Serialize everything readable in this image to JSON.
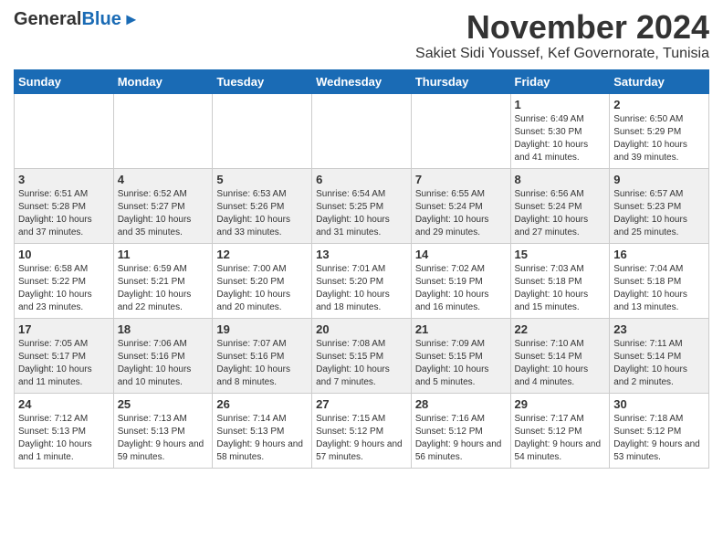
{
  "header": {
    "logo_general": "General",
    "logo_blue": "Blue",
    "month_title": "November 2024",
    "location": "Sakiet Sidi Youssef, Kef Governorate, Tunisia"
  },
  "calendar": {
    "days_of_week": [
      "Sunday",
      "Monday",
      "Tuesday",
      "Wednesday",
      "Thursday",
      "Friday",
      "Saturday"
    ],
    "weeks": [
      [
        {
          "day": "",
          "info": ""
        },
        {
          "day": "",
          "info": ""
        },
        {
          "day": "",
          "info": ""
        },
        {
          "day": "",
          "info": ""
        },
        {
          "day": "",
          "info": ""
        },
        {
          "day": "1",
          "info": "Sunrise: 6:49 AM\nSunset: 5:30 PM\nDaylight: 10 hours and 41 minutes."
        },
        {
          "day": "2",
          "info": "Sunrise: 6:50 AM\nSunset: 5:29 PM\nDaylight: 10 hours and 39 minutes."
        }
      ],
      [
        {
          "day": "3",
          "info": "Sunrise: 6:51 AM\nSunset: 5:28 PM\nDaylight: 10 hours and 37 minutes."
        },
        {
          "day": "4",
          "info": "Sunrise: 6:52 AM\nSunset: 5:27 PM\nDaylight: 10 hours and 35 minutes."
        },
        {
          "day": "5",
          "info": "Sunrise: 6:53 AM\nSunset: 5:26 PM\nDaylight: 10 hours and 33 minutes."
        },
        {
          "day": "6",
          "info": "Sunrise: 6:54 AM\nSunset: 5:25 PM\nDaylight: 10 hours and 31 minutes."
        },
        {
          "day": "7",
          "info": "Sunrise: 6:55 AM\nSunset: 5:24 PM\nDaylight: 10 hours and 29 minutes."
        },
        {
          "day": "8",
          "info": "Sunrise: 6:56 AM\nSunset: 5:24 PM\nDaylight: 10 hours and 27 minutes."
        },
        {
          "day": "9",
          "info": "Sunrise: 6:57 AM\nSunset: 5:23 PM\nDaylight: 10 hours and 25 minutes."
        }
      ],
      [
        {
          "day": "10",
          "info": "Sunrise: 6:58 AM\nSunset: 5:22 PM\nDaylight: 10 hours and 23 minutes."
        },
        {
          "day": "11",
          "info": "Sunrise: 6:59 AM\nSunset: 5:21 PM\nDaylight: 10 hours and 22 minutes."
        },
        {
          "day": "12",
          "info": "Sunrise: 7:00 AM\nSunset: 5:20 PM\nDaylight: 10 hours and 20 minutes."
        },
        {
          "day": "13",
          "info": "Sunrise: 7:01 AM\nSunset: 5:20 PM\nDaylight: 10 hours and 18 minutes."
        },
        {
          "day": "14",
          "info": "Sunrise: 7:02 AM\nSunset: 5:19 PM\nDaylight: 10 hours and 16 minutes."
        },
        {
          "day": "15",
          "info": "Sunrise: 7:03 AM\nSunset: 5:18 PM\nDaylight: 10 hours and 15 minutes."
        },
        {
          "day": "16",
          "info": "Sunrise: 7:04 AM\nSunset: 5:18 PM\nDaylight: 10 hours and 13 minutes."
        }
      ],
      [
        {
          "day": "17",
          "info": "Sunrise: 7:05 AM\nSunset: 5:17 PM\nDaylight: 10 hours and 11 minutes."
        },
        {
          "day": "18",
          "info": "Sunrise: 7:06 AM\nSunset: 5:16 PM\nDaylight: 10 hours and 10 minutes."
        },
        {
          "day": "19",
          "info": "Sunrise: 7:07 AM\nSunset: 5:16 PM\nDaylight: 10 hours and 8 minutes."
        },
        {
          "day": "20",
          "info": "Sunrise: 7:08 AM\nSunset: 5:15 PM\nDaylight: 10 hours and 7 minutes."
        },
        {
          "day": "21",
          "info": "Sunrise: 7:09 AM\nSunset: 5:15 PM\nDaylight: 10 hours and 5 minutes."
        },
        {
          "day": "22",
          "info": "Sunrise: 7:10 AM\nSunset: 5:14 PM\nDaylight: 10 hours and 4 minutes."
        },
        {
          "day": "23",
          "info": "Sunrise: 7:11 AM\nSunset: 5:14 PM\nDaylight: 10 hours and 2 minutes."
        }
      ],
      [
        {
          "day": "24",
          "info": "Sunrise: 7:12 AM\nSunset: 5:13 PM\nDaylight: 10 hours and 1 minute."
        },
        {
          "day": "25",
          "info": "Sunrise: 7:13 AM\nSunset: 5:13 PM\nDaylight: 9 hours and 59 minutes."
        },
        {
          "day": "26",
          "info": "Sunrise: 7:14 AM\nSunset: 5:13 PM\nDaylight: 9 hours and 58 minutes."
        },
        {
          "day": "27",
          "info": "Sunrise: 7:15 AM\nSunset: 5:12 PM\nDaylight: 9 hours and 57 minutes."
        },
        {
          "day": "28",
          "info": "Sunrise: 7:16 AM\nSunset: 5:12 PM\nDaylight: 9 hours and 56 minutes."
        },
        {
          "day": "29",
          "info": "Sunrise: 7:17 AM\nSunset: 5:12 PM\nDaylight: 9 hours and 54 minutes."
        },
        {
          "day": "30",
          "info": "Sunrise: 7:18 AM\nSunset: 5:12 PM\nDaylight: 9 hours and 53 minutes."
        }
      ]
    ]
  }
}
